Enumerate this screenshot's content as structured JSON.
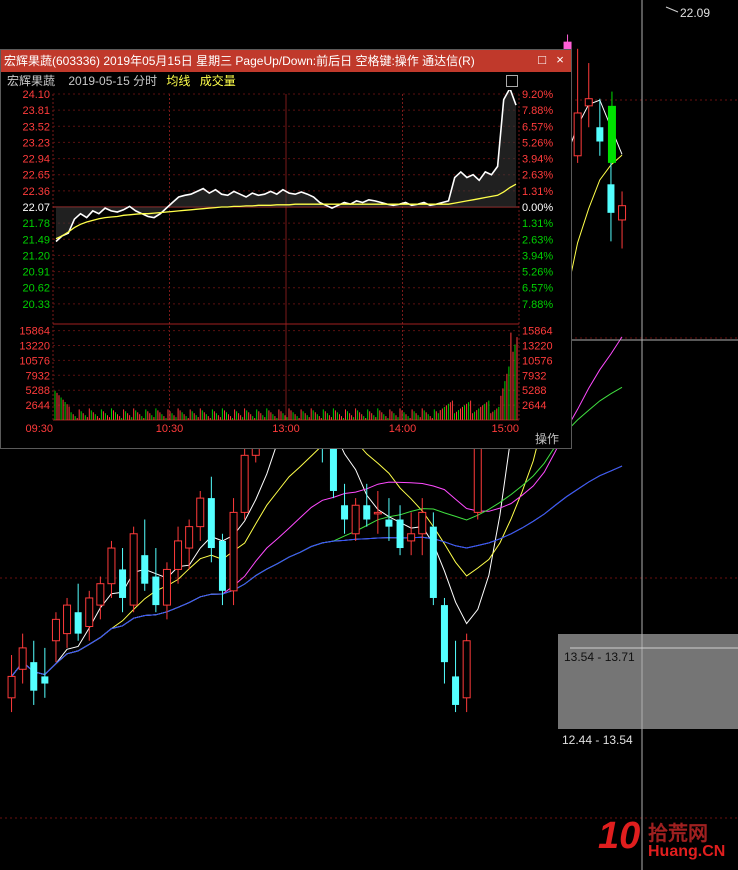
{
  "kline": {
    "high_label": "22.09",
    "range_labels": [
      "13.54 - 13.71",
      "12.44 - 13.54"
    ],
    "chart_data": {
      "type": "candlestick",
      "ylim": [
        11.8,
        22.4
      ],
      "candles": [
        {
          "o": 12.7,
          "h": 13.3,
          "l": 12.5,
          "c": 13.0
        },
        {
          "o": 13.1,
          "h": 13.6,
          "l": 12.9,
          "c": 13.4
        },
        {
          "o": 13.2,
          "h": 13.5,
          "l": 12.6,
          "c": 12.8
        },
        {
          "o": 13.0,
          "h": 13.4,
          "l": 12.7,
          "c": 12.9
        },
        {
          "o": 13.5,
          "h": 13.9,
          "l": 13.2,
          "c": 13.8
        },
        {
          "o": 13.6,
          "h": 14.1,
          "l": 13.4,
          "c": 14.0
        },
        {
          "o": 13.9,
          "h": 14.3,
          "l": 13.5,
          "c": 13.6
        },
        {
          "o": 13.7,
          "h": 14.2,
          "l": 13.5,
          "c": 14.1
        },
        {
          "o": 14.0,
          "h": 14.4,
          "l": 13.8,
          "c": 14.3
        },
        {
          "o": 14.3,
          "h": 14.9,
          "l": 14.1,
          "c": 14.8
        },
        {
          "o": 14.5,
          "h": 14.8,
          "l": 13.9,
          "c": 14.1
        },
        {
          "o": 14.0,
          "h": 15.1,
          "l": 13.9,
          "c": 15.0
        },
        {
          "o": 14.7,
          "h": 15.2,
          "l": 14.2,
          "c": 14.3
        },
        {
          "o": 14.4,
          "h": 14.8,
          "l": 13.9,
          "c": 14.0
        },
        {
          "o": 14.0,
          "h": 14.6,
          "l": 13.8,
          "c": 14.5
        },
        {
          "o": 14.5,
          "h": 15.1,
          "l": 14.3,
          "c": 14.9
        },
        {
          "o": 14.8,
          "h": 15.2,
          "l": 14.5,
          "c": 15.1
        },
        {
          "o": 15.1,
          "h": 15.6,
          "l": 14.9,
          "c": 15.5
        },
        {
          "o": 15.5,
          "h": 15.8,
          "l": 14.6,
          "c": 14.8
        },
        {
          "o": 14.9,
          "h": 15.0,
          "l": 14.0,
          "c": 14.2
        },
        {
          "o": 14.2,
          "h": 15.5,
          "l": 14.0,
          "c": 15.3
        },
        {
          "o": 15.3,
          "h": 16.2,
          "l": 15.2,
          "c": 16.1
        },
        {
          "o": 16.1,
          "h": 17.5,
          "l": 16.0,
          "c": 17.0
        },
        {
          "o": 16.9,
          "h": 17.2,
          "l": 16.4,
          "c": 16.6
        },
        {
          "o": 16.6,
          "h": 16.8,
          "l": 16.2,
          "c": 16.5
        },
        {
          "o": 16.6,
          "h": 17.1,
          "l": 16.3,
          "c": 16.9
        },
        {
          "o": 16.8,
          "h": 17.3,
          "l": 16.4,
          "c": 16.5
        },
        {
          "o": 16.5,
          "h": 17.2,
          "l": 16.3,
          "c": 17.0
        },
        {
          "o": 16.8,
          "h": 17.0,
          "l": 16.0,
          "c": 16.3
        },
        {
          "o": 16.5,
          "h": 16.9,
          "l": 15.5,
          "c": 15.6
        },
        {
          "o": 15.4,
          "h": 15.7,
          "l": 15.0,
          "c": 15.2
        },
        {
          "o": 15.0,
          "h": 15.5,
          "l": 14.9,
          "c": 15.4
        },
        {
          "o": 15.4,
          "h": 15.7,
          "l": 15.1,
          "c": 15.2
        },
        {
          "o": 15.3,
          "h": 15.6,
          "l": 15.0,
          "c": 15.3
        },
        {
          "o": 15.2,
          "h": 15.5,
          "l": 14.9,
          "c": 15.1
        },
        {
          "o": 15.2,
          "h": 15.4,
          "l": 14.7,
          "c": 14.8
        },
        {
          "o": 14.9,
          "h": 15.3,
          "l": 14.7,
          "c": 15.0
        },
        {
          "o": 15.0,
          "h": 15.5,
          "l": 14.7,
          "c": 15.3
        },
        {
          "o": 15.1,
          "h": 15.3,
          "l": 14.0,
          "c": 14.1
        },
        {
          "o": 14.0,
          "h": 14.1,
          "l": 12.9,
          "c": 13.2
        },
        {
          "o": 13.0,
          "h": 13.5,
          "l": 12.5,
          "c": 12.6
        },
        {
          "o": 12.7,
          "h": 13.6,
          "l": 12.5,
          "c": 13.5
        },
        {
          "o": 15.3,
          "h": 16.4,
          "l": 15.2,
          "c": 16.3
        },
        {
          "o": 16.4,
          "h": 17.2,
          "l": 16.3,
          "c": 16.5
        },
        {
          "o": 16.5,
          "h": 17.5,
          "l": 16.4,
          "c": 17.4
        },
        {
          "o": 17.3,
          "h": 18.4,
          "l": 17.2,
          "c": 18.2
        },
        {
          "o": 18.1,
          "h": 19.0,
          "l": 17.9,
          "c": 18.8
        },
        {
          "o": 18.8,
          "h": 19.9,
          "l": 18.6,
          "c": 19.6
        },
        {
          "o": 19.6,
          "h": 20.5,
          "l": 19.5,
          "c": 20.2
        },
        {
          "o": 20.2,
          "h": 21.5,
          "l": 20.1,
          "c": 21.4
        },
        {
          "o": 21.0,
          "h": 21.9,
          "l": 20.2,
          "c": 21.5
        },
        {
          "o": 20.3,
          "h": 21.8,
          "l": 20.2,
          "c": 20.9
        },
        {
          "o": 21.0,
          "h": 21.6,
          "l": 20.7,
          "c": 21.1
        },
        {
          "o": 20.7,
          "h": 21.1,
          "l": 20.3,
          "c": 20.5
        },
        {
          "o": 19.9,
          "h": 20.3,
          "l": 19.1,
          "c": 19.5
        },
        {
          "o": 19.4,
          "h": 19.8,
          "l": 19.0,
          "c": 19.6
        }
      ],
      "limit_candles": [
        {
          "index": 50,
          "o": 20.7,
          "h": 22.0,
          "l": 20.6,
          "c": 21.9,
          "color": "#ff5fd7"
        },
        {
          "index": 54,
          "o": 21.0,
          "h": 21.2,
          "l": 20.2,
          "c": 20.2,
          "color": "#00e000"
        }
      ]
    }
  },
  "popup": {
    "title": "宏辉果蔬(603336) 2019年05月15日 星期三 PageUp/Down:前后日 空格键:操作 通达信(R)",
    "close_label": "×",
    "max_label": "□",
    "stock_name": "宏辉果蔬",
    "date_label": "2019-05-15 分时",
    "avg_label": "均线",
    "vol_label": "成交量",
    "ops_label": "操作",
    "colors": {
      "up": "#ff3b3b",
      "down": "#00d000",
      "neutral": "#ffffff",
      "price": "#ffffff",
      "avg": "#ffff4a",
      "vol_up": "#ff3b3b",
      "vol_down": "#00d000"
    },
    "chart_data": {
      "type": "line",
      "prev_close": 22.07,
      "price_ticks_up": [
        "24.10",
        "23.81",
        "23.52",
        "23.23",
        "22.94",
        "22.65",
        "22.36"
      ],
      "price_tick_mid": "22.07",
      "price_ticks_down": [
        "21.78",
        "21.49",
        "21.20",
        "20.91",
        "20.62",
        "20.33"
      ],
      "pct_ticks_up": [
        "9.20%",
        "7.88%",
        "6.57%",
        "5.26%",
        "3.94%",
        "2.63%",
        "1.31%"
      ],
      "pct_tick_mid": "0.00%",
      "pct_ticks_down": [
        "1.31%",
        "2.63%",
        "3.94%",
        "5.26%",
        "6.57%",
        "7.88%"
      ],
      "vol_ticks": [
        "15864",
        "13220",
        "10576",
        "7932",
        "5288",
        "2644"
      ],
      "time_ticks": [
        "09:30",
        "10:30",
        "13:00",
        "14:00",
        "15:00"
      ],
      "price": [
        21.45,
        21.55,
        21.6,
        21.85,
        21.95,
        21.88,
        22.0,
        21.95,
        22.05,
        22.0,
        21.98,
        22.02,
        22.08,
        22.0,
        21.95,
        21.9,
        21.88,
        21.95,
        22.05,
        22.15,
        22.25,
        22.28,
        22.3,
        22.35,
        22.4,
        22.32,
        22.38,
        22.3,
        22.28,
        22.35,
        22.3,
        22.25,
        22.32,
        22.28,
        22.3,
        22.35,
        22.3,
        22.38,
        22.32,
        22.3,
        22.34,
        22.3,
        22.25,
        22.15,
        22.1,
        22.05,
        22.1,
        22.15,
        22.12,
        22.18,
        22.15,
        22.2,
        22.18,
        22.15,
        22.12,
        22.1,
        22.12,
        22.15,
        22.1,
        22.12,
        22.15,
        22.1,
        22.12,
        22.15,
        22.18,
        22.6,
        22.7,
        22.6,
        22.65,
        22.55,
        22.7,
        22.65,
        22.8,
        24.0,
        24.2,
        23.9
      ],
      "avg": [
        21.5,
        21.55,
        21.62,
        21.7,
        21.76,
        21.8,
        21.83,
        21.86,
        21.88,
        21.89,
        21.9,
        21.92,
        21.93,
        21.94,
        21.95,
        21.95,
        21.96,
        21.97,
        21.98,
        21.99,
        22.0,
        22.01,
        22.02,
        22.03,
        22.04,
        22.05,
        22.06,
        22.07,
        22.07,
        22.08,
        22.08,
        22.09,
        22.09,
        22.1,
        22.1,
        22.1,
        22.11,
        22.11,
        22.11,
        22.12,
        22.12,
        22.12,
        22.12,
        22.12,
        22.12,
        22.12,
        22.12,
        22.12,
        22.12,
        22.12,
        22.12,
        22.12,
        22.12,
        22.12,
        22.12,
        22.12,
        22.12,
        22.12,
        22.12,
        22.12,
        22.12,
        22.12,
        22.12,
        22.12,
        22.12,
        22.14,
        22.16,
        22.18,
        22.2,
        22.22,
        22.24,
        22.26,
        22.28,
        22.34,
        22.42,
        22.48
      ]
    }
  },
  "logo": {
    "num": "10",
    "cn": "拾荒网",
    "en": "Huang.CN"
  }
}
